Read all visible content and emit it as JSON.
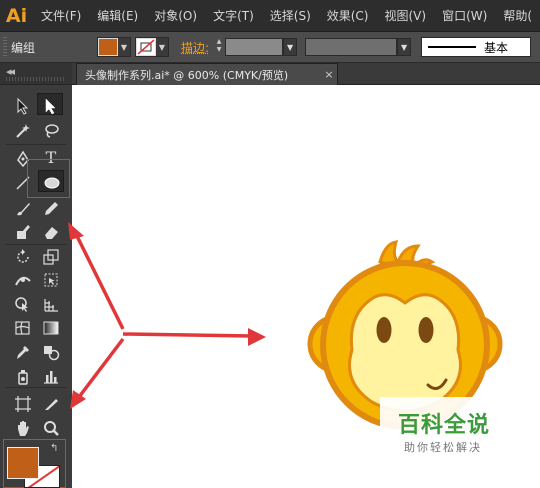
{
  "app": {
    "logo": "Ai"
  },
  "menu": [
    "文件(F)",
    "编辑(E)",
    "对象(O)",
    "文字(T)",
    "选择(S)",
    "效果(C)",
    "视图(V)",
    "窗口(W)",
    "帮助("
  ],
  "control_bar": {
    "selection_label": "编组",
    "fill_color": "#c06018",
    "stroke_label": "描边:",
    "brush_label": "基本"
  },
  "document": {
    "tab_title": "头像制作系列.ai* @ 600% (CMYK/预览)",
    "close": "×"
  },
  "tools": {
    "collapse": "◂◂",
    "type_tool_glyph": "T",
    "active_tool": "ellipse-tool"
  },
  "colors": {
    "fill": "#c06018",
    "highlight_box": "#e0383a",
    "monkey_outer": "#e08a10",
    "monkey_fur": "#f5b400",
    "monkey_face": "#fff3a0",
    "arrow": "#e0383a"
  },
  "watermark": {
    "title": "百科全说",
    "subtitle": "助你轻松解决"
  }
}
